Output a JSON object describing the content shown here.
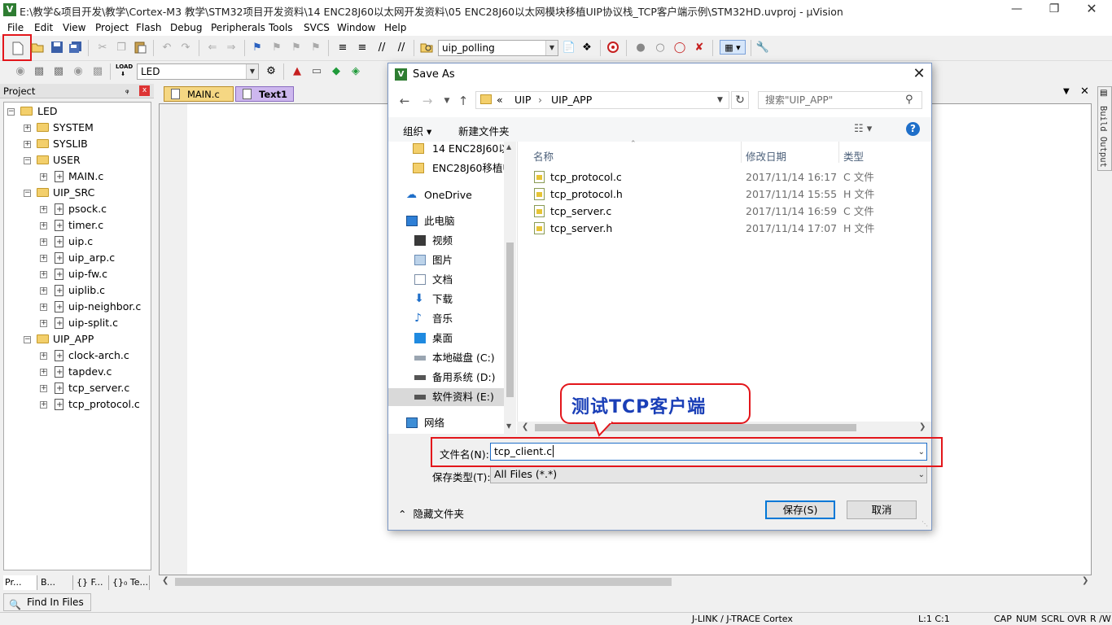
{
  "window": {
    "title": "E:\\教学&项目开发\\教学\\Cortex-M3 教学\\STM32项目开发资料\\14 ENC28J60以太网开发资料\\05 ENC28J60以太网模块移植UIP协议栈_TCP客户端示例\\STM32HD.uvproj - µVision",
    "icon": "V"
  },
  "menu": [
    "File",
    "Edit",
    "View",
    "Project",
    "Flash",
    "Debug",
    "Peripherals",
    "Tools",
    "SVCS",
    "Window",
    "Help"
  ],
  "toolbar": {
    "find_combo": "uip_polling",
    "target_combo": "LED"
  },
  "project": {
    "title": "Project",
    "pin": "ᵩ",
    "close": "x",
    "root": "LED",
    "groups": [
      {
        "name": "SYSTEM",
        "files": []
      },
      {
        "name": "SYSLIB",
        "files": []
      },
      {
        "name": "USER",
        "files": [
          "MAIN.c"
        ]
      },
      {
        "name": "UIP_SRC",
        "files": [
          "psock.c",
          "timer.c",
          "uip.c",
          "uip_arp.c",
          "uip-fw.c",
          "uiplib.c",
          "uip-neighbor.c",
          "uip-split.c"
        ]
      },
      {
        "name": "UIP_APP",
        "files": [
          "clock-arch.c",
          "tapdev.c",
          "tcp_server.c",
          "tcp_protocol.c"
        ]
      }
    ],
    "bottom_tabs": [
      "Pr...",
      "B...",
      "{} F...",
      "{}₀ Te..."
    ]
  },
  "editor": {
    "tabs": [
      "MAIN.c",
      "Text1"
    ],
    "active_tab": "Text1"
  },
  "build_output": "Build Output",
  "find_in_files": "Find In Files",
  "status": {
    "debugger": "J-LINK / J-TRACE Cortex",
    "cursor": "L:1 C:1",
    "indicators": [
      "CAP",
      "NUM",
      "SCRL",
      "OVR",
      "R /W"
    ]
  },
  "dialog": {
    "title": "Save As",
    "address": [
      "«",
      "UIP",
      "›",
      "UIP_APP"
    ],
    "search_placeholder": "搜索\"UIP_APP\"",
    "organize": "组织 ▾",
    "new_folder": "新建文件夹",
    "nav_items": [
      {
        "label": "14 ENC28J60以",
        "icon": "folder-icon"
      },
      {
        "label": "ENC28J60移植U",
        "icon": "folder-icon"
      },
      {
        "label": "OneDrive",
        "icon": "cloud-icon"
      },
      {
        "label": "此电脑",
        "icon": "computer-icon"
      },
      {
        "label": "视频",
        "icon": "video-icon"
      },
      {
        "label": "图片",
        "icon": "picture-icon"
      },
      {
        "label": "文档",
        "icon": "document-icon"
      },
      {
        "label": "下载",
        "icon": "download-icon"
      },
      {
        "label": "音乐",
        "icon": "music-icon"
      },
      {
        "label": "桌面",
        "icon": "desktop-icon"
      },
      {
        "label": "本地磁盘 (C:)",
        "icon": "drive-icon"
      },
      {
        "label": "备用系统 (D:)",
        "icon": "drive-icon"
      },
      {
        "label": "软件资料 (E:)",
        "icon": "drive-icon"
      },
      {
        "label": "网络",
        "icon": "network-icon"
      }
    ],
    "columns": [
      "名称",
      "修改日期",
      "类型"
    ],
    "files": [
      {
        "name": "tcp_protocol.c",
        "date": "2017/11/14 16:17",
        "type": "C 文件"
      },
      {
        "name": "tcp_protocol.h",
        "date": "2017/11/14 15:55",
        "type": "H 文件"
      },
      {
        "name": "tcp_server.c",
        "date": "2017/11/14 16:59",
        "type": "C 文件"
      },
      {
        "name": "tcp_server.h",
        "date": "2017/11/14 17:07",
        "type": "H 文件"
      }
    ],
    "filename_label": "文件名(N):",
    "filename_value": "tcp_client.c",
    "filetype_label": "保存类型(T):",
    "filetype_value": "All Files (*.*)",
    "hide_folders": "隐藏文件夹",
    "save_button": "保存(S)",
    "cancel_button": "取消"
  },
  "callout": {
    "text": "测试TCP客户端"
  },
  "colors": {
    "highlight_red": "#e3161b",
    "callout_text": "#1a3fb7",
    "link_blue": "#1c4b8f"
  }
}
